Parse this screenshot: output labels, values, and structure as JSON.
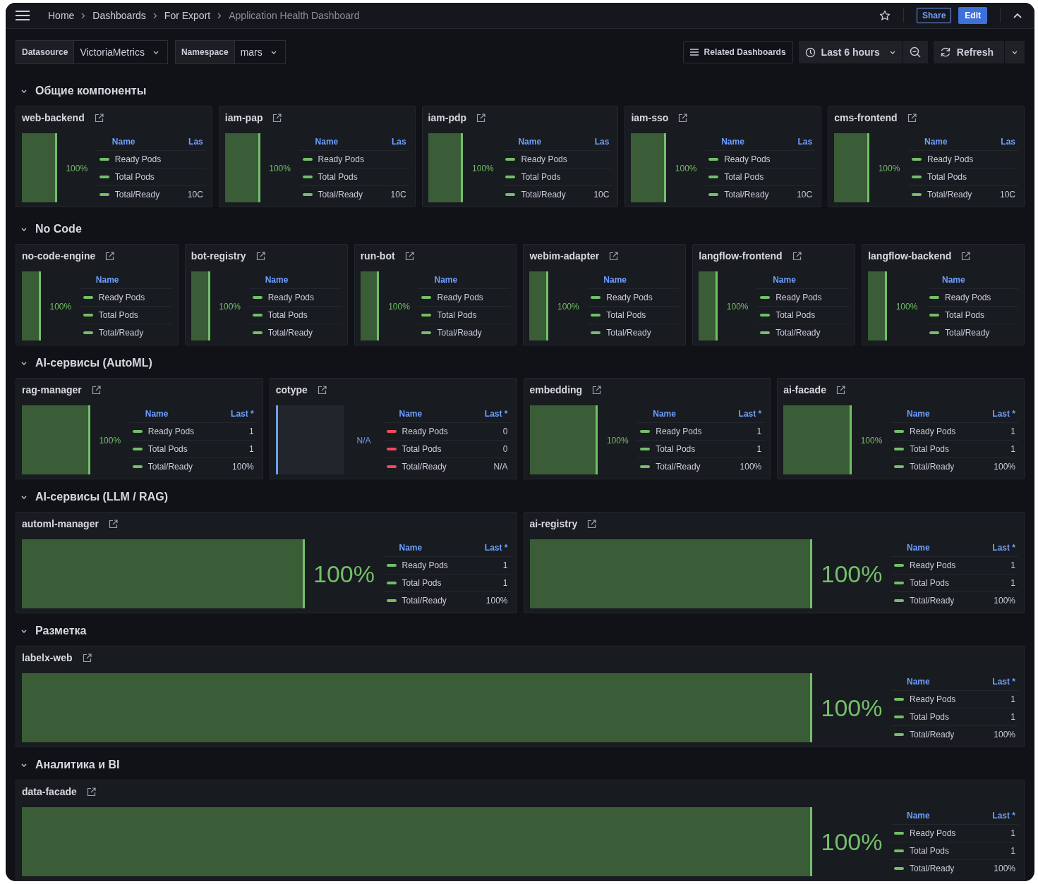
{
  "breadcrumbs": [
    {
      "label": "Home",
      "current": false
    },
    {
      "label": "Dashboards",
      "current": false
    },
    {
      "label": "For Export",
      "current": false
    },
    {
      "label": "Application Health Dashboard",
      "current": true
    }
  ],
  "header_actions": {
    "share": "Share",
    "edit": "Edit"
  },
  "variables": [
    {
      "label": "Datasource",
      "value": "VictoriaMetrics"
    },
    {
      "label": "Namespace",
      "value": "mars"
    }
  ],
  "toolbar": {
    "related": "Related Dashboards",
    "time_range": "Last 6 hours",
    "refresh": "Refresh"
  },
  "sections": [
    {
      "title": "Общие компоненты",
      "expanded": true,
      "panels": [
        {
          "title": "web-backend",
          "has_data": true,
          "value": "100%",
          "columns": [
            "Name",
            "Las"
          ],
          "rows": [
            {
              "name": "Ready Pods"
            },
            {
              "name": "Total Pods"
            },
            {
              "name": "Total/Ready",
              "value": "10C"
            }
          ]
        },
        {
          "title": "iam-pap",
          "has_data": true,
          "value": "100%",
          "columns": [
            "Name",
            "Las"
          ],
          "rows": [
            {
              "name": "Ready Pods"
            },
            {
              "name": "Total Pods"
            },
            {
              "name": "Total/Ready",
              "value": "10C"
            }
          ]
        },
        {
          "title": "iam-pdp",
          "has_data": true,
          "value": "100%",
          "columns": [
            "Name",
            "Las"
          ],
          "rows": [
            {
              "name": "Ready Pods"
            },
            {
              "name": "Total Pods"
            },
            {
              "name": "Total/Ready",
              "value": "10C"
            }
          ]
        },
        {
          "title": "iam-sso",
          "has_data": true,
          "value": "100%",
          "columns": [
            "Name",
            "Las"
          ],
          "rows": [
            {
              "name": "Ready Pods"
            },
            {
              "name": "Total Pods"
            },
            {
              "name": "Total/Ready",
              "value": "10C"
            }
          ]
        },
        {
          "title": "cms-frontend",
          "has_data": true,
          "value": "100%",
          "columns": [
            "Name",
            "Las"
          ],
          "rows": [
            {
              "name": "Ready Pods"
            },
            {
              "name": "Total Pods"
            },
            {
              "name": "Total/Ready",
              "value": "10C"
            }
          ]
        }
      ]
    },
    {
      "title": "No Code",
      "expanded": true,
      "panels": [
        {
          "title": "no-code-engine",
          "has_data": true,
          "value": "100%",
          "columns": [
            "Name"
          ],
          "rows": [
            {
              "name": "Ready Pods"
            },
            {
              "name": "Total Pods"
            },
            {
              "name": "Total/Ready"
            }
          ]
        },
        {
          "title": "bot-registry",
          "has_data": true,
          "value": "100%",
          "columns": [
            "Name"
          ],
          "rows": [
            {
              "name": "Ready Pods"
            },
            {
              "name": "Total Pods"
            },
            {
              "name": "Total/Ready"
            }
          ]
        },
        {
          "title": "run-bot",
          "has_data": true,
          "value": "100%",
          "columns": [
            "Name"
          ],
          "rows": [
            {
              "name": "Ready Pods"
            },
            {
              "name": "Total Pods"
            },
            {
              "name": "Total/Ready"
            }
          ]
        },
        {
          "title": "webim-adapter",
          "has_data": true,
          "value": "100%",
          "columns": [
            "Name"
          ],
          "rows": [
            {
              "name": "Ready Pods"
            },
            {
              "name": "Total Pods"
            },
            {
              "name": "Total/Ready"
            }
          ]
        },
        {
          "title": "langflow-frontend",
          "has_data": true,
          "value": "100%",
          "columns": [
            "Name"
          ],
          "rows": [
            {
              "name": "Ready Pods"
            },
            {
              "name": "Total Pods"
            },
            {
              "name": "Total/Ready"
            }
          ]
        },
        {
          "title": "langflow-backend",
          "has_data": true,
          "value": "100%",
          "columns": [
            "Name"
          ],
          "rows": [
            {
              "name": "Ready Pods"
            },
            {
              "name": "Total Pods"
            },
            {
              "name": "Total/Ready"
            }
          ]
        }
      ]
    },
    {
      "title": "AI-сервисы (AutoML)",
      "expanded": true,
      "panels": [
        {
          "title": "rag-manager",
          "has_data": true,
          "value": "100%",
          "columns": [
            "Name",
            "Last *"
          ],
          "rows": [
            {
              "name": "Ready Pods",
              "value": "1"
            },
            {
              "name": "Total Pods",
              "value": "1"
            },
            {
              "name": "Total/Ready",
              "value": "100%"
            }
          ]
        },
        {
          "title": "cotype",
          "has_data": false,
          "value": "N/A",
          "columns": [
            "Name",
            "Last *"
          ],
          "rows": [
            {
              "name": "Ready Pods",
              "value": "0"
            },
            {
              "name": "Total Pods",
              "value": "0"
            },
            {
              "name": "Total/Ready",
              "value": "N/A"
            }
          ]
        },
        {
          "title": "embedding",
          "has_data": true,
          "value": "100%",
          "columns": [
            "Name",
            "Last *"
          ],
          "rows": [
            {
              "name": "Ready Pods",
              "value": "1"
            },
            {
              "name": "Total Pods",
              "value": "1"
            },
            {
              "name": "Total/Ready",
              "value": "100%"
            }
          ]
        },
        {
          "title": "ai-facade",
          "has_data": true,
          "value": "100%",
          "columns": [
            "Name",
            "Last *"
          ],
          "rows": [
            {
              "name": "Ready Pods",
              "value": "1"
            },
            {
              "name": "Total Pods",
              "value": "1"
            },
            {
              "name": "Total/Ready",
              "value": "100%"
            }
          ]
        }
      ]
    },
    {
      "title": "AI-сервисы (LLM / RAG)",
      "expanded": true,
      "panels": [
        {
          "title": "automl-manager",
          "has_data": true,
          "value": "100%",
          "columns": [
            "Name",
            "Last *"
          ],
          "rows": [
            {
              "name": "Ready Pods",
              "value": "1"
            },
            {
              "name": "Total Pods",
              "value": "1"
            },
            {
              "name": "Total/Ready",
              "value": "100%"
            }
          ]
        },
        {
          "title": "ai-registry",
          "has_data": true,
          "value": "100%",
          "columns": [
            "Name",
            "Last *"
          ],
          "rows": [
            {
              "name": "Ready Pods",
              "value": "1"
            },
            {
              "name": "Total Pods",
              "value": "1"
            },
            {
              "name": "Total/Ready",
              "value": "100%"
            }
          ]
        }
      ]
    },
    {
      "title": "Разметка",
      "expanded": true,
      "panels": [
        {
          "title": "labelx-web",
          "has_data": true,
          "value": "100%",
          "columns": [
            "Name",
            "Last *"
          ],
          "rows": [
            {
              "name": "Ready Pods",
              "value": "1"
            },
            {
              "name": "Total Pods",
              "value": "1"
            },
            {
              "name": "Total/Ready",
              "value": "100%"
            }
          ]
        }
      ]
    },
    {
      "title": "Аналитика и BI",
      "expanded": true,
      "panels": [
        {
          "title": "data-facade",
          "has_data": true,
          "value": "100%",
          "columns": [
            "Name",
            "Last *"
          ],
          "rows": [
            {
              "name": "Ready Pods",
              "value": "1"
            },
            {
              "name": "Total Pods",
              "value": "1"
            },
            {
              "name": "Total/Ready",
              "value": "100%"
            }
          ]
        }
      ]
    }
  ]
}
